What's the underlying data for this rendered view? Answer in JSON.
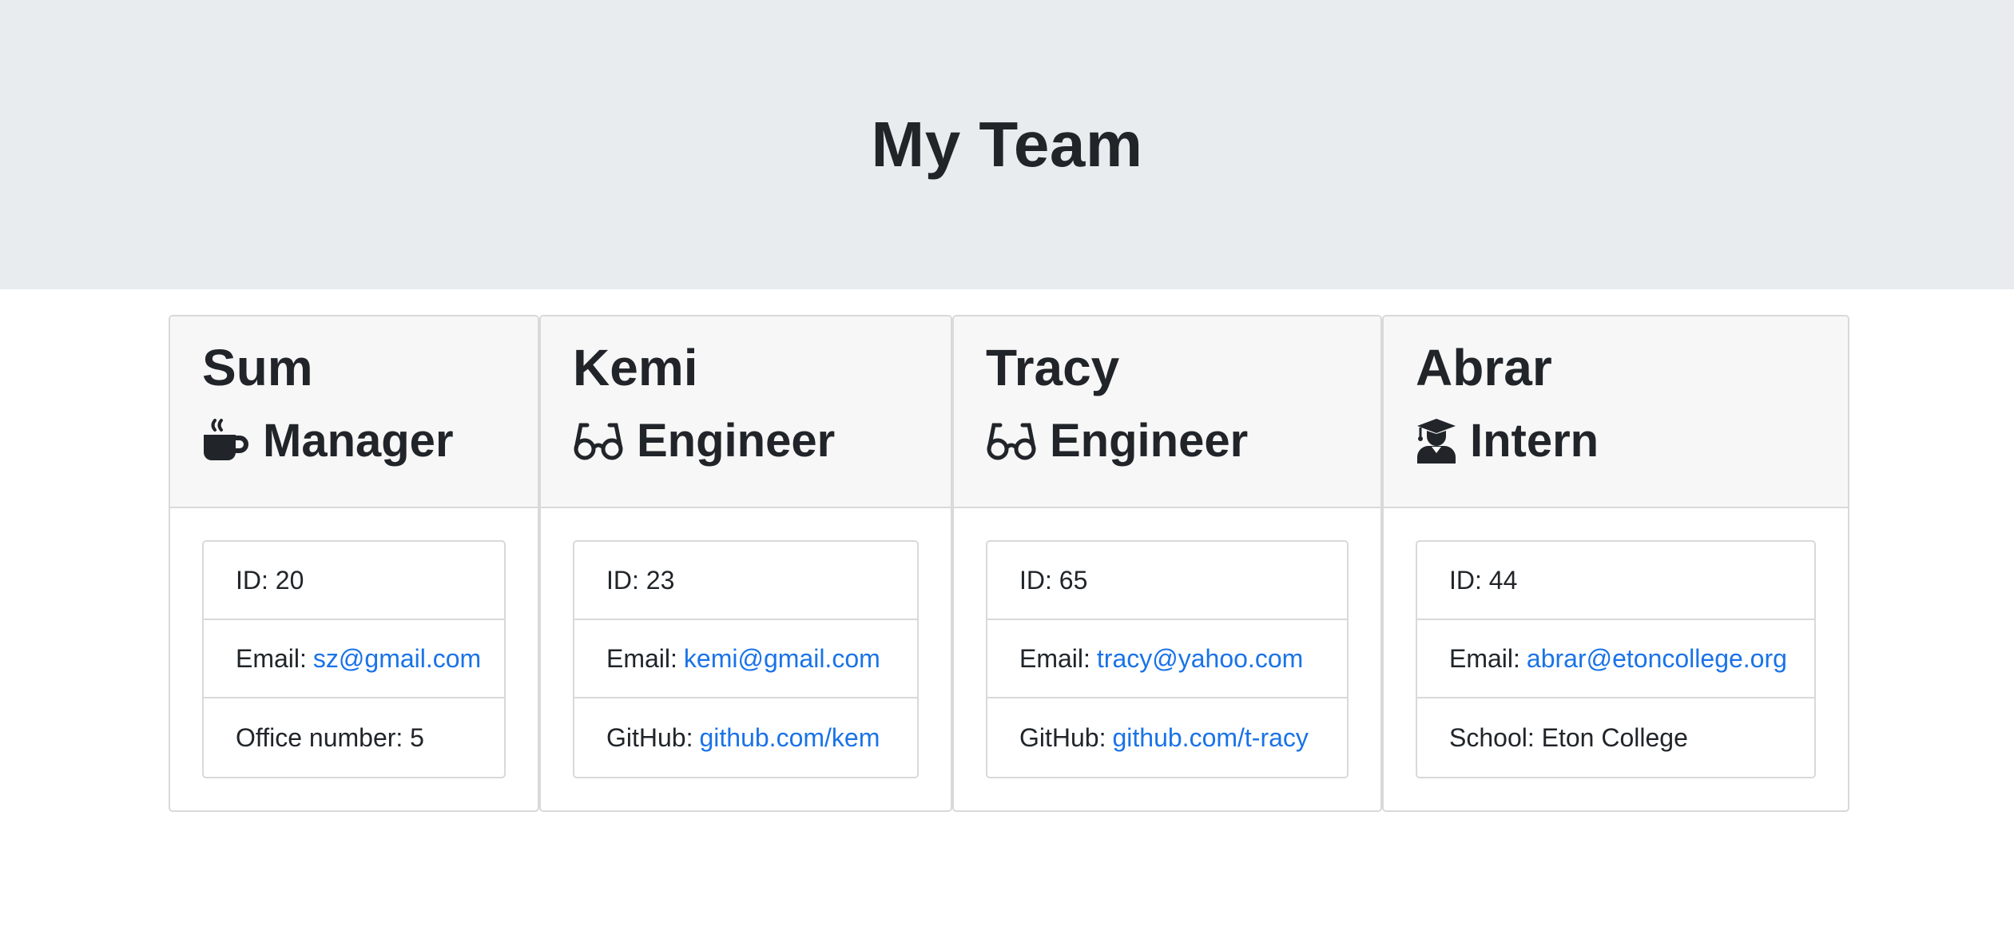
{
  "header": {
    "title": "My Team"
  },
  "team": [
    {
      "name": "Sum",
      "role": "Manager",
      "icon": "coffee-mug-icon",
      "id_label": "ID: 20",
      "email_label": "Email:",
      "email": "sz@gmail.com",
      "extra_label": "Office number: 5",
      "extra_link": ""
    },
    {
      "name": "Kemi",
      "role": "Engineer",
      "icon": "glasses-icon",
      "id_label": "ID: 23",
      "email_label": "Email:",
      "email": "kemi@gmail.com",
      "extra_label": "GitHub:",
      "extra_link": "github.com/kem"
    },
    {
      "name": "Tracy",
      "role": "Engineer",
      "icon": "glasses-icon",
      "id_label": "ID: 65",
      "email_label": "Email:",
      "email": "tracy@yahoo.com",
      "extra_label": "GitHub:",
      "extra_link": "github.com/t-racy"
    },
    {
      "name": "Abrar",
      "role": "Intern",
      "icon": "graduate-icon",
      "id_label": "ID: 44",
      "email_label": "Email:",
      "email": "abrar@etoncollege.org",
      "extra_label": "School: Eton College",
      "extra_link": ""
    }
  ],
  "colors": {
    "jumbotron_bg": "#e9ecef",
    "card_header_bg": "#f7f7f7",
    "link": "#1a73e8",
    "text": "#212529"
  }
}
